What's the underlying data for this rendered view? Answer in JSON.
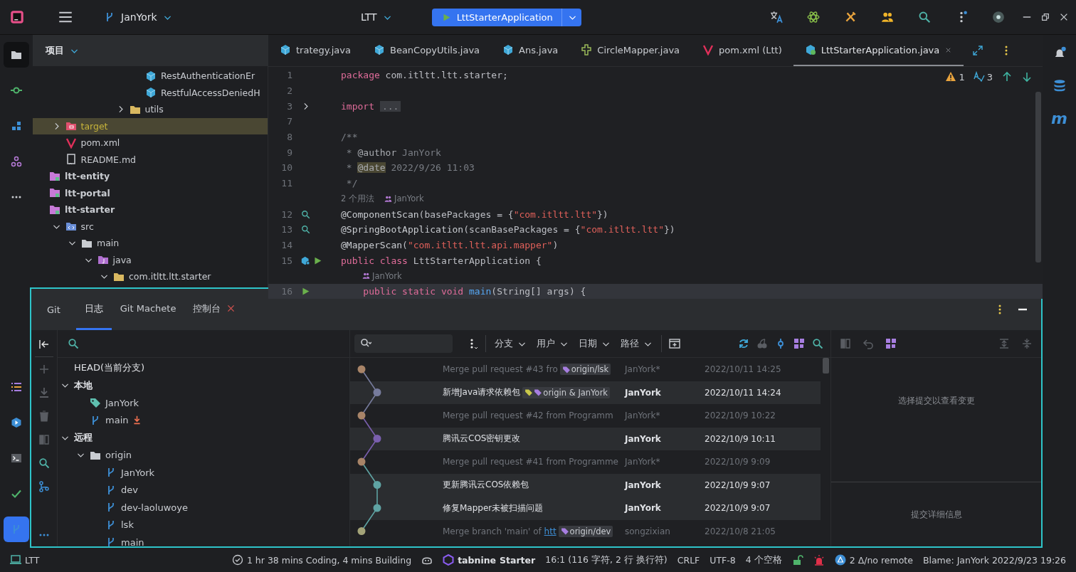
{
  "title_bar": {
    "branch": "JanYork",
    "project": "LTT",
    "run_configuration": "LttStarterApplication"
  },
  "activity_bar": {
    "top": [
      {
        "kind": "folder",
        "selected": true
      },
      {
        "kind": "commit",
        "selected": false
      },
      {
        "kind": "structure",
        "selected": false
      },
      {
        "kind": "graph",
        "selected": false
      },
      {
        "kind": "more",
        "selected": false
      }
    ],
    "bottom": [
      {
        "kind": "todo",
        "selected": false
      },
      {
        "kind": "run",
        "selected": false
      },
      {
        "kind": "terminal",
        "selected": false
      },
      {
        "kind": "check",
        "selected": false
      },
      {
        "kind": "branch",
        "selected": true
      }
    ]
  },
  "project": {
    "title": "项目",
    "tree": [
      {
        "children": [
          {
            "children": [
              {
                "children": [
                  {
                    "children": [
                      {
                        "children": [
                          {
                            "children": [
                              {
                                "label": "RestAuthenticationEr",
                                "kind": "class",
                                "selected": false
                              },
                              {
                                "label": "RestfulAccessDeniedH",
                                "kind": "class",
                                "selected": false
                              }
                            ]
                          },
                          {
                            "label": "utils",
                            "kind": "package",
                            "expanded": false,
                            "selected": false
                          }
                        ]
                      }
                    ]
                  }
                ]
              }
            ]
          },
          {
            "label": "target",
            "kind": "excluded",
            "expanded": false,
            "selected": true
          },
          {
            "label": "pom.xml",
            "kind": "maven",
            "selected": false
          },
          {
            "label": "README.md",
            "kind": "markdown",
            "selected": false
          }
        ]
      },
      {
        "label": "ltt-entity",
        "kind": "module",
        "selected": false
      },
      {
        "label": "ltt-portal",
        "kind": "module",
        "selected": false
      },
      {
        "label": "ltt-starter",
        "kind": "module",
        "selected": false,
        "children": [
          {
            "label": "src",
            "kind": "source",
            "expanded": true,
            "selected": false,
            "children": [
              {
                "label": "main",
                "kind": "folder",
                "expanded": true,
                "selected": false,
                "children": [
                  {
                    "label": "java",
                    "kind": "java",
                    "expanded": true,
                    "selected": false,
                    "children": [
                      {
                        "label": "com.itltt.ltt.starter",
                        "kind": "package",
                        "expanded": true,
                        "selected": false
                      }
                    ]
                  }
                ]
              }
            ]
          }
        ]
      }
    ]
  },
  "editor": {
    "tabs": [
      {
        "label": "trategy.java",
        "kind": "class",
        "selected": false
      },
      {
        "label": "BeanCopyUtils.java",
        "kind": "class",
        "selected": false
      },
      {
        "label": "Ans.java",
        "kind": "class",
        "selected": false
      },
      {
        "label": "CircleMapper.java",
        "kind": "mapper",
        "selected": false
      },
      {
        "label": "pom.xml (Ltt)",
        "kind": "maven",
        "selected": false
      },
      {
        "label": "LttStarterApplication.java",
        "kind": "boot",
        "selected": true
      }
    ],
    "warnings": "1",
    "typos": "3",
    "lines": [
      {
        "kind": "code",
        "number": "1",
        "segments": [
          {
            "kind": "keyword",
            "text": "package"
          },
          {
            "kind": "plain",
            "text": " com.itltt.ltt.starter;"
          }
        ]
      },
      {
        "kind": "code",
        "number": "2"
      },
      {
        "kind": "code",
        "number": "3",
        "gutter": [
          {
            "kind": "fold"
          }
        ],
        "segments": [
          {
            "kind": "keyword",
            "text": "import"
          },
          {
            "kind": "folded",
            "text": "..."
          }
        ]
      },
      {
        "kind": "code",
        "number": "7"
      },
      {
        "kind": "code",
        "number": "8",
        "segments": [
          {
            "kind": "comment",
            "text": "/**"
          }
        ]
      },
      {
        "kind": "code",
        "number": "9",
        "segments": [
          {
            "kind": "comment",
            "text": " * "
          },
          {
            "kind": "doctag",
            "text": "@author"
          },
          {
            "kind": "comment",
            "text": " JanYork"
          }
        ]
      },
      {
        "kind": "code",
        "number": "10",
        "segments": [
          {
            "kind": "comment",
            "text": " * "
          },
          {
            "kind": "doctag-hit",
            "text": "@date"
          },
          {
            "kind": "comment",
            "text": " 2022/9/26 11:03"
          }
        ]
      },
      {
        "kind": "code",
        "number": "11",
        "segments": [
          {
            "kind": "comment",
            "text": " */"
          }
        ]
      },
      {
        "kind": "hint",
        "usages": "2 个用法",
        "author": "JanYork"
      },
      {
        "kind": "code",
        "number": "12",
        "gutter": [
          {
            "kind": "search"
          }
        ],
        "segments": [
          {
            "kind": "annotation",
            "text": "@ComponentScan"
          },
          {
            "kind": "plain",
            "text": "(basePackages = {"
          },
          {
            "kind": "string",
            "text": "\"com.itltt.ltt\""
          },
          {
            "kind": "plain",
            "text": "})"
          }
        ]
      },
      {
        "kind": "code",
        "number": "13",
        "gutter": [
          {
            "kind": "search"
          }
        ],
        "segments": [
          {
            "kind": "annotation",
            "text": "@SpringBootApplication"
          },
          {
            "kind": "plain",
            "text": "(scanBasePackages = {"
          },
          {
            "kind": "string",
            "text": "\"com.itltt.ltt\""
          },
          {
            "kind": "plain",
            "text": "})"
          }
        ]
      },
      {
        "kind": "code",
        "number": "14",
        "segments": [
          {
            "kind": "annotation",
            "text": "@MapperScan"
          },
          {
            "kind": "plain",
            "text": "("
          },
          {
            "kind": "string",
            "text": "\"com.itltt.ltt.api.mapper\""
          },
          {
            "kind": "plain",
            "text": ")"
          }
        ]
      },
      {
        "kind": "code",
        "number": "15",
        "gutter": [
          {
            "kind": "bean"
          },
          {
            "kind": "run"
          }
        ],
        "segments": [
          {
            "kind": "keyword",
            "text": "public class "
          },
          {
            "kind": "plain",
            "text": "LttStarterApplication {"
          }
        ]
      },
      {
        "kind": "hint",
        "author": "JanYork"
      },
      {
        "kind": "code",
        "number": "16",
        "gutter": [
          {
            "kind": "run"
          }
        ],
        "current": true,
        "segments": [
          {
            "kind": "keyword",
            "text": "    public static void "
          },
          {
            "kind": "method",
            "text": "main"
          },
          {
            "kind": "plain",
            "text": "(String[] args) {"
          }
        ]
      }
    ]
  },
  "right_bar": {
    "maven_label": "m"
  },
  "git": {
    "title": "Git",
    "tabs": [
      {
        "label": "日志",
        "selected": true,
        "closable": false
      },
      {
        "label": "Git Machete",
        "selected": false,
        "closable": false
      },
      {
        "label": "控制台",
        "selected": false,
        "closable": true
      }
    ],
    "branches": [
      {
        "label": "HEAD(当前分支)",
        "kind": "head"
      },
      {
        "label": "本地",
        "kind": "group",
        "expanded": true,
        "children": [
          {
            "label": "JanYork",
            "kind": "tag",
            "incoming": false
          },
          {
            "label": "main",
            "kind": "branch",
            "incoming": true
          }
        ]
      },
      {
        "label": "远程",
        "kind": "group",
        "expanded": true,
        "children": [
          {
            "label": "origin",
            "kind": "folder",
            "expanded": true,
            "children": [
              {
                "label": "JanYork",
                "kind": "branch",
                "incoming": false
              },
              {
                "label": "dev",
                "kind": "branch",
                "incoming": false
              },
              {
                "label": "dev-laoluwoye",
                "kind": "branch",
                "incoming": false
              },
              {
                "label": "lsk",
                "kind": "branch",
                "incoming": false
              },
              {
                "label": "main",
                "kind": "branch",
                "incoming": false
              }
            ]
          }
        ]
      }
    ],
    "filters": [
      "分支",
      "用户",
      "日期",
      "路径"
    ],
    "commits": [
      {
        "kind": "merge",
        "color": "#a88468",
        "message": "Merge pull request #43 fro",
        "refs": [
          {
            "label": "origin/lsk",
            "icons": [
              {
                "color": "#a77ee0"
              }
            ]
          }
        ],
        "author": "JanYork*",
        "date": "2022/10/11 14:25"
      },
      {
        "kind": "commit",
        "color": "#767b9c",
        "message": "新增Java请求依赖包",
        "refs": [
          {
            "label": "origin & JanYork",
            "icons": [
              {
                "color": "#c8c84a"
              },
              {
                "color": "#a77ee0"
              }
            ]
          }
        ],
        "author": "JanYork",
        "date": "2022/10/11 14:24"
      },
      {
        "kind": "merge",
        "color": "#a88468",
        "message": "Merge pull request #42 from Programm",
        "author": "JanYork*",
        "date": "2022/10/9 10:22"
      },
      {
        "kind": "commit",
        "color": "#7a5fae",
        "message": "腾讯云COS密钥更改",
        "author": "JanYork",
        "date": "2022/10/9 10:11"
      },
      {
        "kind": "merge",
        "color": "#a88468",
        "message": "Merge pull request #41 from Programme",
        "author": "JanYork*",
        "date": "2022/10/9 9:09"
      },
      {
        "kind": "commit",
        "color": "#5fa3a3",
        "message": "更新腾讯云COS依赖包",
        "author": "JanYork",
        "date": "2022/10/9 9:07"
      },
      {
        "kind": "commit",
        "color": "#5fa3a3",
        "message": "修复Mapper未被扫描问题",
        "author": "JanYork",
        "date": "2022/10/9 9:07"
      },
      {
        "kind": "merge",
        "color": "#a3a378",
        "message": "Merge branch 'main' of ",
        "link": "htt",
        "refs": [
          {
            "label": "origin/dev",
            "icons": [
              {
                "color": "#a77ee0"
              }
            ]
          }
        ],
        "author": "songzixian",
        "date": "2022/10/8 21:05"
      }
    ],
    "changes_placeholder": "选择提交以查看变更",
    "details_placeholder": "提交详细信息"
  },
  "status_bar": {
    "project": "LTT",
    "time_tracking": "1 hr 38 mins Coding, 4 mins Building",
    "tabnine": "tabnine",
    "tabnine_plan": "Starter",
    "position": "16:1 (116 字符, 2 行 换行符)",
    "line_separator": "CRLF",
    "encoding": "UTF-8",
    "indent": "4 个空格",
    "vcs": "2 Δ/no remote",
    "blame": "Blame: JanYork 2022/9/23 19:26"
  }
}
